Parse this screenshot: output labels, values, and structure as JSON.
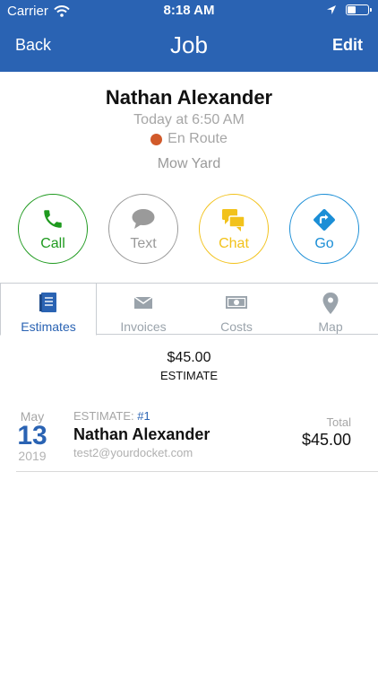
{
  "status_bar": {
    "carrier": "Carrier",
    "time": "8:18 AM",
    "battery_level": 0.45
  },
  "nav": {
    "back_label": "Back",
    "title": "Job",
    "edit_label": "Edit"
  },
  "customer": {
    "name": "Nathan Alexander",
    "time": "Today at 6:50 AM",
    "status": "En Route",
    "status_color": "#d15a2a",
    "job_name": "Mow Yard"
  },
  "actions": [
    {
      "label": "Call",
      "icon": "phone-icon",
      "color": "#1f9a1f"
    },
    {
      "label": "Text",
      "icon": "speech-bubble-icon",
      "color": "#9a9a9a"
    },
    {
      "label": "Chat",
      "icon": "chat-bubbles-icon",
      "color": "#f2c21b"
    },
    {
      "label": "Go",
      "icon": "directions-icon",
      "color": "#1b8ed6"
    }
  ],
  "tabs": [
    {
      "label": "Estimates",
      "icon": "document-icon",
      "active": true
    },
    {
      "label": "Invoices",
      "icon": "envelope-icon",
      "active": false
    },
    {
      "label": "Costs",
      "icon": "money-icon",
      "active": false
    },
    {
      "label": "Map",
      "icon": "map-pin-icon",
      "active": false
    }
  ],
  "summary": {
    "amount": "$45.00",
    "label": "ESTIMATE"
  },
  "estimates": [
    {
      "month": "May",
      "day": "13",
      "year": "2019",
      "estimate_label": "ESTIMATE:",
      "estimate_number": "#1",
      "name": "Nathan Alexander",
      "email": "test2@yourdocket.com",
      "total_label": "Total",
      "total": "$45.00"
    }
  ],
  "colors": {
    "header": "#2a63b3",
    "accent": "#2a63b3"
  }
}
